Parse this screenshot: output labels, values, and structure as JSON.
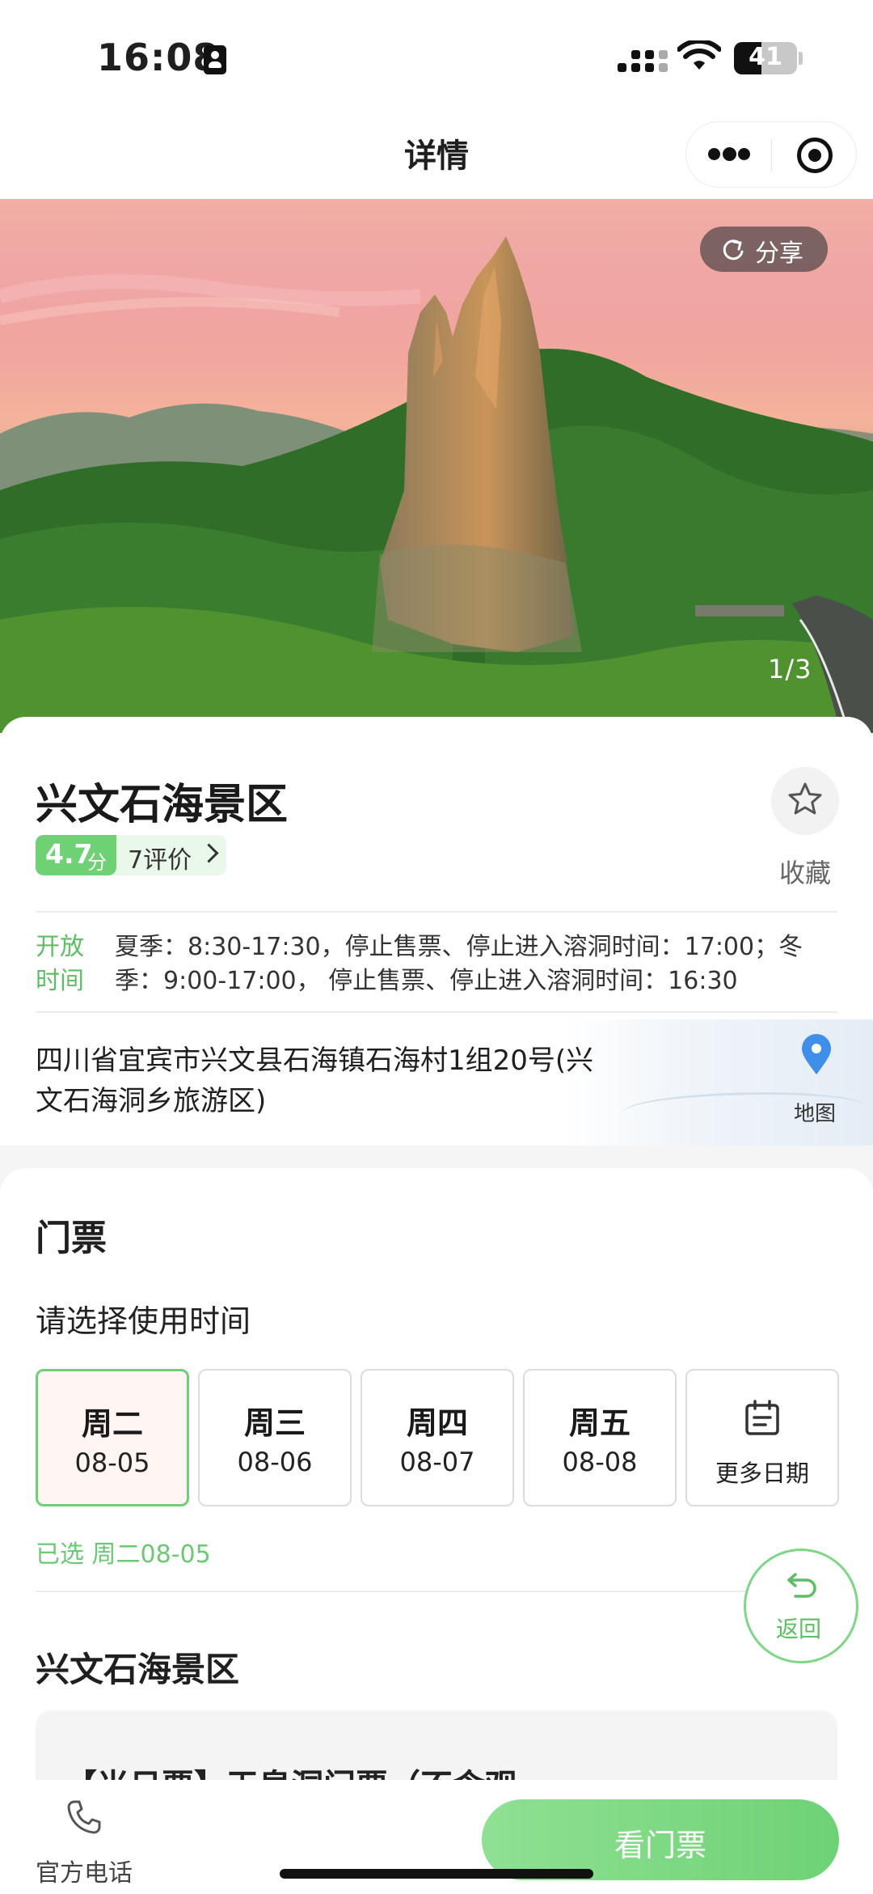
{
  "status_bar": {
    "time": "16:08",
    "battery": "41"
  },
  "nav": {
    "title": "详情"
  },
  "hero": {
    "share_label": "分享",
    "page_indicator": "1/3"
  },
  "scenic": {
    "name": "兴文石海景区",
    "rating_score": "4.7",
    "rating_unit": "分",
    "review_count": "7评价",
    "favorite_label": "收藏",
    "open_hours_label": "开放时间",
    "open_hours_text": "夏季：8:30-17:30，停止售票、停止进入溶洞时间：17:00；冬季：9:00-17:00， 停止售票、停止进入溶洞时间：16:30",
    "address": "四川省宜宾市兴文县石海镇石海村1组20号(兴文石海洞乡旅游区)",
    "map_label": "地图"
  },
  "tickets": {
    "heading": "门票",
    "date_prompt": "请选择使用时间",
    "dates": [
      {
        "day": "周二",
        "md": "08-05"
      },
      {
        "day": "周三",
        "md": "08-06"
      },
      {
        "day": "周四",
        "md": "08-07"
      },
      {
        "day": "周五",
        "md": "08-08"
      }
    ],
    "more_dates_label": "更多日期",
    "selected_text": "已选 周二08-05",
    "section_title": "兴文石海景区",
    "package_peek": "【当日票】天泉洞门票（不含观..."
  },
  "floating": {
    "back_label": "返回"
  },
  "bottom_bar": {
    "phone_label": "官方电话",
    "tickets_button": "看门票"
  },
  "colors": {
    "accent_green": "#6ed275",
    "selected_bg": "#fff6f4"
  },
  "icons": [
    "id-card-icon",
    "signal-icon",
    "wifi-icon",
    "battery-icon",
    "more-icon",
    "target-icon",
    "share-icon",
    "star-icon",
    "map-pin-icon",
    "calendar-icon",
    "back-arrow-icon",
    "phone-icon"
  ]
}
